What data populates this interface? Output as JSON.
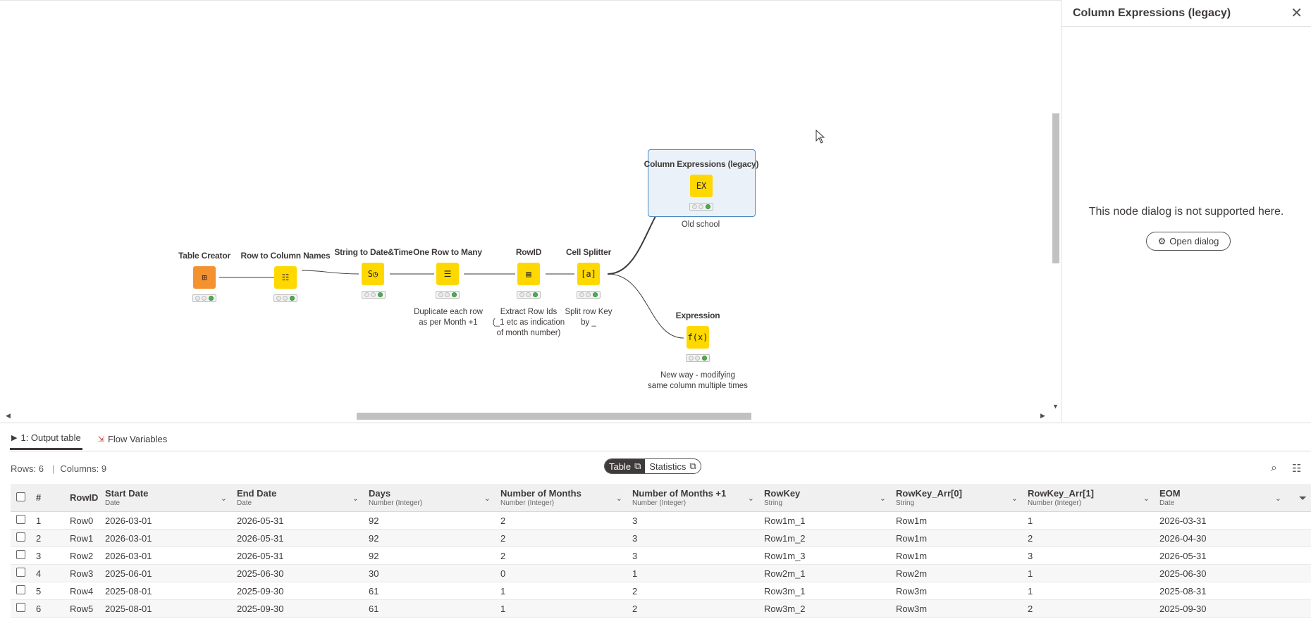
{
  "workflow": {
    "nodes": [
      {
        "id": "table-creator",
        "title": "Table Creator",
        "desc": [],
        "icon": "⊞",
        "kind": "source"
      },
      {
        "id": "row-to-column-names",
        "title": "Row to Column Names",
        "desc": [],
        "icon": "☷",
        "kind": "manip"
      },
      {
        "id": "string-to-datetime",
        "title": "String to Date&Time",
        "desc": [],
        "icon": "S◷",
        "kind": "manip"
      },
      {
        "id": "one-row-to-many",
        "title": "One Row to Many",
        "desc": [
          "Duplicate each row",
          "as per Month +1"
        ],
        "icon": "☰",
        "kind": "manip"
      },
      {
        "id": "rowid",
        "title": "RowID",
        "desc": [
          "Extract Row Ids",
          "(_1 etc as indication",
          "of month number)"
        ],
        "icon": "▤",
        "kind": "manip"
      },
      {
        "id": "cell-splitter",
        "title": "Cell Splitter",
        "desc": [
          "Split row Key",
          "by _"
        ],
        "icon": "[a]",
        "kind": "manip"
      },
      {
        "id": "column-expressions-legacy",
        "title": "Column Expressions (legacy)",
        "desc": [
          "Old school"
        ],
        "icon": "EX",
        "kind": "manip"
      },
      {
        "id": "expression",
        "title": "Expression",
        "desc": [
          "New way - modifying",
          "same column multiple times"
        ],
        "icon": "f(x)",
        "kind": "manip"
      }
    ]
  },
  "side_panel": {
    "title": "Column Expressions (legacy)",
    "message": "This node dialog is not supported here.",
    "open_dialog_label": "Open dialog"
  },
  "bottom": {
    "tabs": [
      {
        "label": "1: Output table",
        "active": true
      },
      {
        "label": "Flow Variables",
        "active": false
      }
    ],
    "rows_label": "Rows: 6",
    "columns_label": "Columns: 9",
    "view_toggle": {
      "table": "Table",
      "statistics": "Statistics"
    }
  },
  "table": {
    "index_header": "#",
    "rowid_header": "RowID",
    "columns": [
      {
        "name": "Start Date",
        "type": "Date"
      },
      {
        "name": "End Date",
        "type": "Date"
      },
      {
        "name": "Days",
        "type": "Number (Integer)"
      },
      {
        "name": "Number of Months",
        "type": "Number (Integer)"
      },
      {
        "name": "Number of Months +1",
        "type": "Number (Integer)"
      },
      {
        "name": "RowKey",
        "type": "String"
      },
      {
        "name": "RowKey_Arr[0]",
        "type": "String"
      },
      {
        "name": "RowKey_Arr[1]",
        "type": "Number (Integer)"
      },
      {
        "name": "EOM",
        "type": "Date"
      }
    ],
    "rows": [
      {
        "idx": "1",
        "rowid": "Row0",
        "cells": [
          "2026-03-01",
          "2026-05-31",
          "92",
          "2",
          "3",
          "Row1m_1",
          "Row1m",
          "1",
          "2026-03-31"
        ]
      },
      {
        "idx": "2",
        "rowid": "Row1",
        "cells": [
          "2026-03-01",
          "2026-05-31",
          "92",
          "2",
          "3",
          "Row1m_2",
          "Row1m",
          "2",
          "2026-04-30"
        ]
      },
      {
        "idx": "3",
        "rowid": "Row2",
        "cells": [
          "2026-03-01",
          "2026-05-31",
          "92",
          "2",
          "3",
          "Row1m_3",
          "Row1m",
          "3",
          "2026-05-31"
        ]
      },
      {
        "idx": "4",
        "rowid": "Row3",
        "cells": [
          "2025-06-01",
          "2025-06-30",
          "30",
          "0",
          "1",
          "Row2m_1",
          "Row2m",
          "1",
          "2025-06-30"
        ]
      },
      {
        "idx": "5",
        "rowid": "Row4",
        "cells": [
          "2025-08-01",
          "2025-09-30",
          "61",
          "1",
          "2",
          "Row3m_1",
          "Row3m",
          "1",
          "2025-08-31"
        ]
      },
      {
        "idx": "6",
        "rowid": "Row5",
        "cells": [
          "2025-08-01",
          "2025-09-30",
          "61",
          "1",
          "2",
          "Row3m_2",
          "Row3m",
          "2",
          "2025-09-30"
        ]
      }
    ]
  }
}
